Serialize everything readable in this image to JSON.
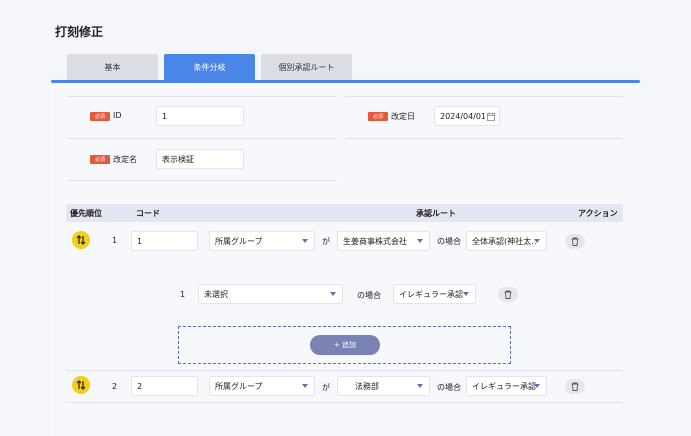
{
  "page": {
    "title": "打刻修正"
  },
  "tabs": [
    {
      "label": "基本"
    },
    {
      "label": "条件分岐"
    },
    {
      "label": "個別承認ルート"
    }
  ],
  "form": {
    "required_label": "必須",
    "id_label": "ID",
    "id_value": "1",
    "date_label": "改定日",
    "date_value": "2024/04/01",
    "name_label": "改定名",
    "name_value": "表示検証"
  },
  "table": {
    "headers": {
      "priority": "優先順位",
      "code": "コード",
      "route": "承認ルート",
      "action": "アクション"
    },
    "rows": [
      {
        "priority": "1",
        "code": "1",
        "group": "所属グループ",
        "ga": "が",
        "target": "生姜商事株式会社",
        "case": "の場合",
        "route": "全体承認(神社太…"
      },
      {
        "priority": "2",
        "code": "2",
        "group": "所属グループ",
        "ga": "が",
        "target": "法務部",
        "case": "の場合",
        "route": "イレギュラー承認"
      }
    ],
    "sub_row": {
      "index": "1",
      "condition": "未選択",
      "case": "の場合",
      "route": "イレギュラー承認"
    },
    "add_label": "+ 追加"
  },
  "colors": {
    "accent": "#4a86e8",
    "required": "#e8593c",
    "handle": "#f1cf1a"
  }
}
